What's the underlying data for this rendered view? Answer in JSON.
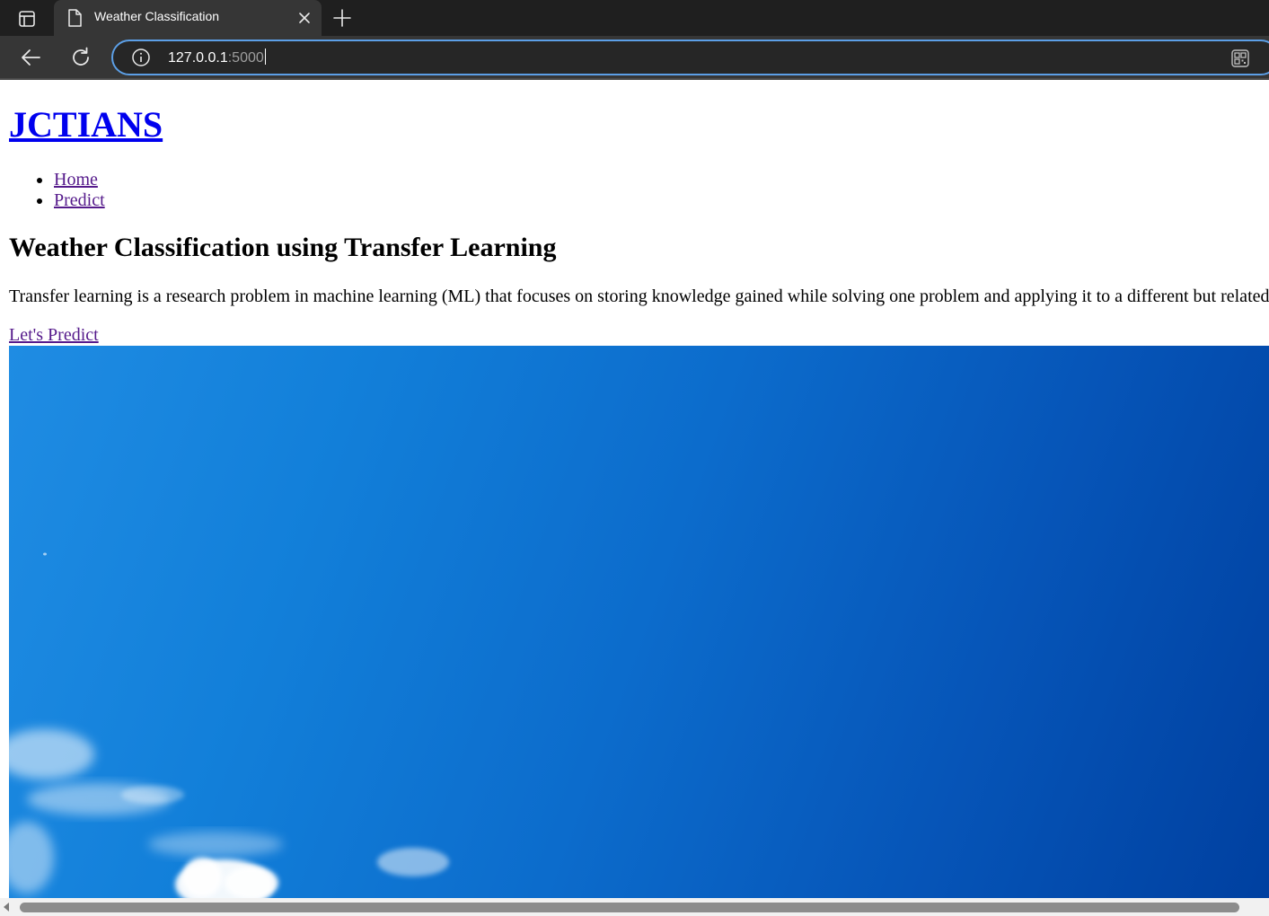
{
  "browser": {
    "tab_title": "Weather Classification",
    "url_host": "127.0.0.1",
    "url_port": ":5000"
  },
  "page": {
    "brand": "JCTIANS",
    "nav": [
      {
        "label": "Home"
      },
      {
        "label": "Predict"
      }
    ],
    "heading": "Weather Classification using Transfer Learning",
    "description": "Transfer learning is a research problem in machine learning (ML) that focuses on storing knowledge gained while solving one problem and applying it to a different but related",
    "cta": "Let's Predict"
  },
  "colors": {
    "chrome_dark": "#1f1f1f",
    "chrome_toolbar": "#363636",
    "omnibox_focus": "#5c9fe6",
    "link": "#0000ee",
    "visited_link": "#551a8b",
    "sky_light": "#1f8ce3",
    "sky_dark": "#0040a0"
  },
  "icons": {
    "tab_actions": "tab-actions-icon",
    "tab_favicon": "page-icon",
    "tab_close": "close-icon",
    "new_tab": "plus-icon",
    "back": "back-arrow-icon",
    "reload": "reload-icon",
    "site_info": "info-icon",
    "qr": "qr-code-icon"
  }
}
